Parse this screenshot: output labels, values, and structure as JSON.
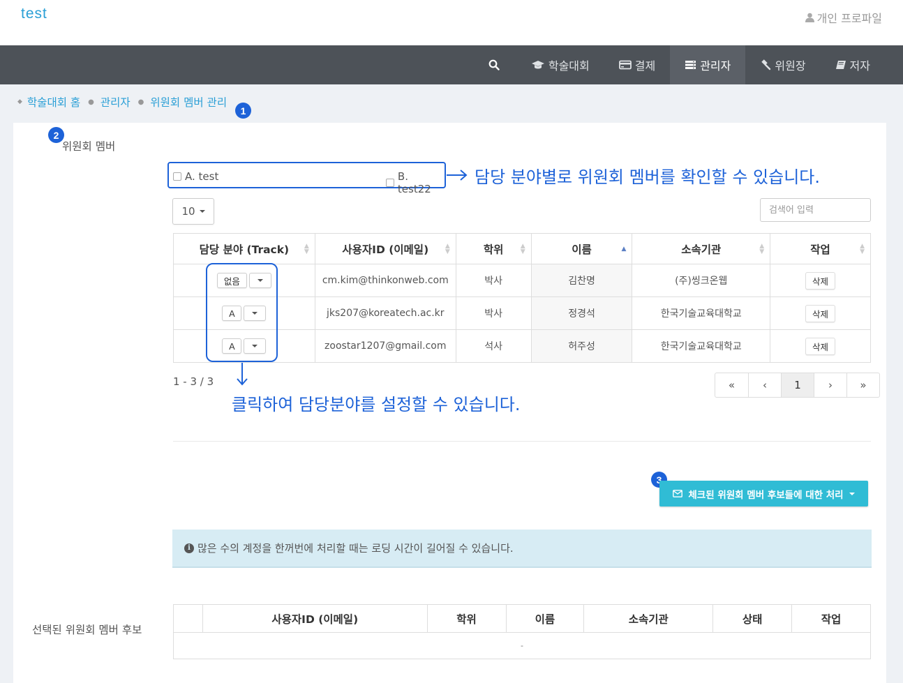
{
  "header": {
    "brand": "test",
    "profile_label": "개인 프로파일"
  },
  "nav": {
    "items": [
      {
        "label": "학술대회"
      },
      {
        "label": "결제"
      },
      {
        "label": "관리자"
      },
      {
        "label": "위원장"
      },
      {
        "label": "저자"
      }
    ]
  },
  "breadcrumb": {
    "home": "학술대회 홈",
    "admin": "관리자",
    "current": "위원회 멤버 관리"
  },
  "badges": {
    "b1": "1",
    "b2": "2",
    "b3": "3"
  },
  "members_section": {
    "label": "위원회 멤버",
    "tracks": [
      {
        "label": "A. test"
      },
      {
        "label": "B. test22"
      }
    ],
    "page_size": "10",
    "search_placeholder": "검색어 입력",
    "columns": [
      "담당 분야 (Track)",
      "사용자ID (이메일)",
      "학위",
      "이름",
      "소속기관",
      "작업"
    ],
    "rows": [
      {
        "track": "없음",
        "email": "cm.kim@thinkonweb.com",
        "degree": "박사",
        "name": "김찬명",
        "org": "(주)씽크온웹",
        "action": "삭제"
      },
      {
        "track": "A",
        "email": "jks207@koreatech.ac.kr",
        "degree": "박사",
        "name": "정경석",
        "org": "한국기술교육대학교",
        "action": "삭제"
      },
      {
        "track": "A",
        "email": "zoostar1207@gmail.com",
        "degree": "석사",
        "name": "허주성",
        "org": "한국기술교육대학교",
        "action": "삭제"
      }
    ],
    "count_text": "1 - 3 / 3",
    "pagination": [
      "«",
      "‹",
      "1",
      "›",
      "»"
    ]
  },
  "annotations": {
    "track_filter": "담당 분야별로 위원회 멤버를 확인할 수 있습니다.",
    "track_set": "클릭하여 담당분야를 설정할 수 있습니다."
  },
  "candidate_action": {
    "label": "체크된 위원회 멤버 후보들에 대한 처리"
  },
  "alert": {
    "text": "많은 수의 계정을 한꺼번에 처리할 때는 로딩 시간이 길어질 수 있습니다."
  },
  "candidates_section": {
    "label": "선택된 위원회 멤버 후보",
    "columns": [
      "사용자ID (이메일)",
      "학위",
      "이름",
      "소속기관",
      "상태",
      "작업"
    ],
    "empty": "-"
  },
  "colors": {
    "accent_blue": "#1d62d8",
    "link": "#2a9fd6",
    "nav_bg": "#4d5258",
    "action_btn": "#30bcd5",
    "alert_bg": "#d7ecf4"
  }
}
